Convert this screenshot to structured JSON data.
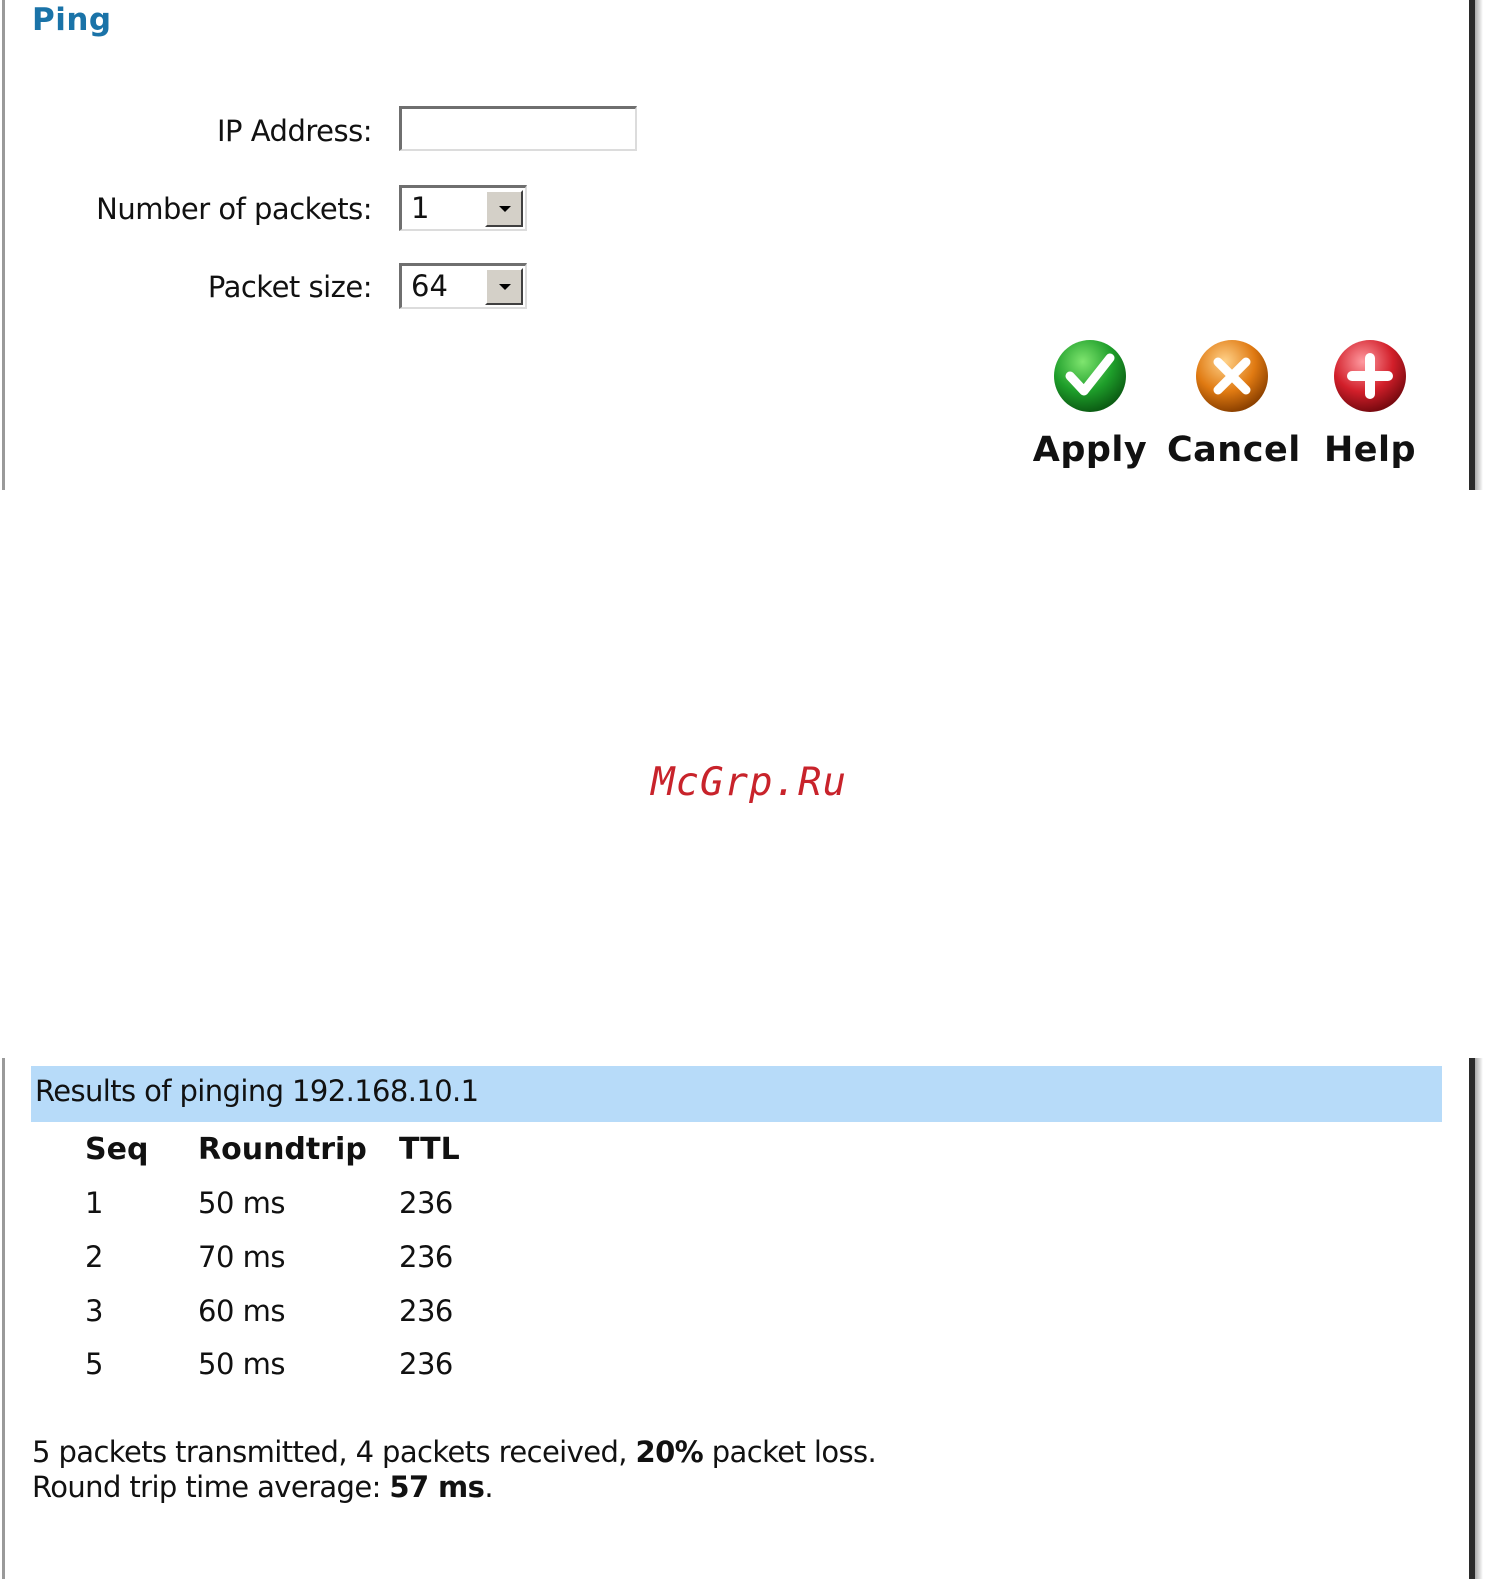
{
  "page": {
    "title": "Ping"
  },
  "form": {
    "ip_address": {
      "label": "IP Address:",
      "value": ""
    },
    "num_packets": {
      "label": "Number of packets:",
      "value": "1"
    },
    "packet_size": {
      "label": "Packet size:",
      "value": "64"
    }
  },
  "actions": {
    "apply": {
      "label": "Apply",
      "color": "#1e9e2a"
    },
    "cancel": {
      "label": "Cancel",
      "color": "#e07a12"
    },
    "help": {
      "label": "Help",
      "color": "#d21f2a"
    }
  },
  "watermark": "McGrp.Ru",
  "results": {
    "header": "Results of pinging 192.168.10.1",
    "columns": [
      "Seq",
      "Roundtrip",
      "TTL"
    ],
    "rows": [
      {
        "seq": "1",
        "roundtrip": "50 ms",
        "ttl": "236"
      },
      {
        "seq": "2",
        "roundtrip": "70 ms",
        "ttl": "236"
      },
      {
        "seq": "3",
        "roundtrip": "60 ms",
        "ttl": "236"
      },
      {
        "seq": "5",
        "roundtrip": "50 ms",
        "ttl": "236"
      }
    ],
    "summary": {
      "transmitted_prefix": "5 packets transmitted, 4 packets received,",
      "loss_value": "20%",
      "loss_suffix": "packet loss.",
      "avg_prefix": "Round trip time average:",
      "avg_value": "57 ms",
      "avg_suffix": "."
    }
  }
}
